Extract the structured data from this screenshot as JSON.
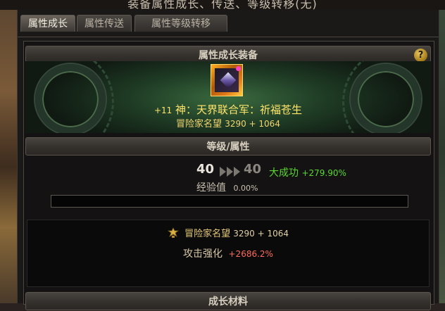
{
  "window_title": "装备属性成长、传送、等级转移(无)",
  "tabs": [
    {
      "label": "属性成长",
      "active": true
    },
    {
      "label": "属性传送",
      "active": false
    },
    {
      "label": "属性等级转移",
      "active": false
    }
  ],
  "equip_section": {
    "header": "属性成长装备",
    "help_label": "?",
    "item": {
      "upgrade": "+11",
      "name": "神：天界联合军：祈福苍生",
      "fame_label": "冒险家名望",
      "fame_value": "3290 + 1064",
      "rarity_color": "#ffb020"
    }
  },
  "level_section": {
    "header": "等级/属性",
    "current_level": "40",
    "next_level": "40",
    "result_label": "大成功",
    "result_value": "+279.90%",
    "exp_label": "经验值",
    "exp_value": "0.00%",
    "exp_progress": 0.0
  },
  "stats": {
    "fame_label": "冒险家名望",
    "fame_value": "3290 + 1064",
    "attack_label": "攻击强化",
    "attack_value": "+2686.2%"
  },
  "material_section": {
    "header": "成长材料"
  },
  "icons": [
    "help-icon",
    "level-arrow-icon",
    "fame-emblem-icon",
    "gem-icon"
  ]
}
